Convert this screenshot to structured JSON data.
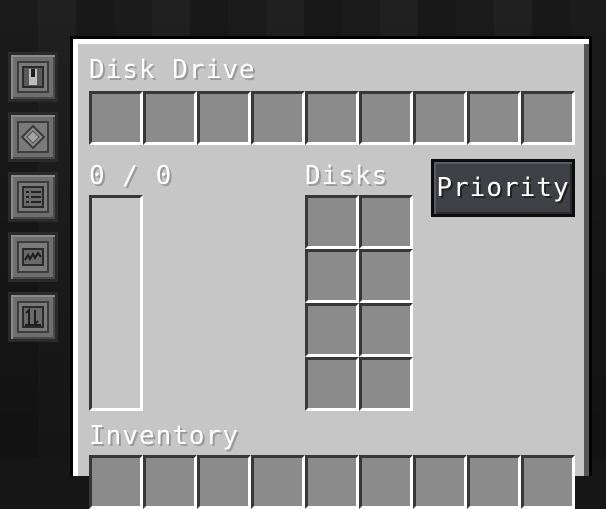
{
  "side_tabs": [
    {
      "icon": "redstone-control-icon"
    },
    {
      "icon": "filter-icon"
    },
    {
      "icon": "whitelist-icon"
    },
    {
      "icon": "storage-type-icon"
    },
    {
      "icon": "access-type-icon"
    }
  ],
  "panel": {
    "title": "Disk Drive",
    "filter_slot_count": 9,
    "capacity_text": "0 / 0",
    "capacity_fraction": 0,
    "disks_label": "Disks",
    "disk_slot_count": 8,
    "priority_label": "Priority",
    "inventory_label": "Inventory",
    "inventory_visible_slots": 9
  },
  "colors": {
    "panel_bg": "#c6c6c6",
    "slot_bg": "#8b8b8b",
    "button_bg": "#3f3f46",
    "text": "#ffffff"
  }
}
